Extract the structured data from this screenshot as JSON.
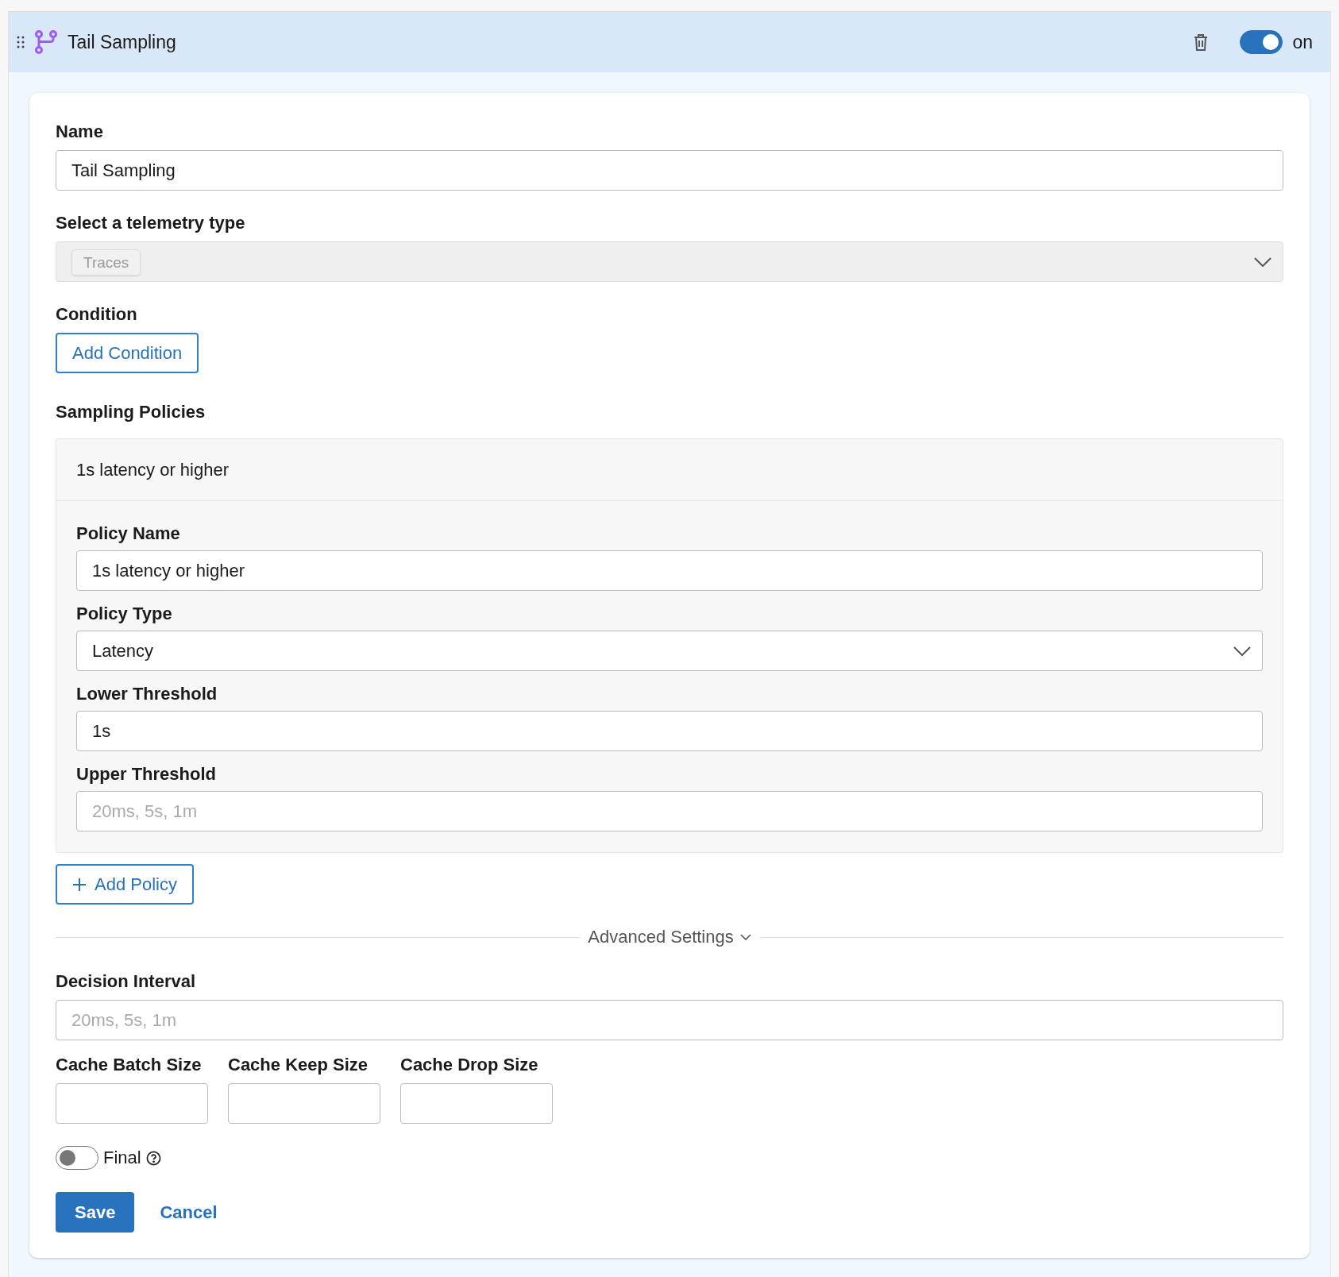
{
  "header": {
    "title": "Tail Sampling",
    "enabled": true,
    "toggle_label": "on"
  },
  "name": {
    "label": "Name",
    "value": "Tail Sampling"
  },
  "telemetry": {
    "label": "Select a telemetry type",
    "disabled": true,
    "tags": [
      "Traces"
    ]
  },
  "condition": {
    "label": "Condition",
    "button": "Add Condition"
  },
  "policies": {
    "label": "Sampling Policies",
    "items": [
      {
        "title": "1s latency or higher",
        "fields": [
          {
            "kind": "input",
            "label": "Policy Name",
            "value": "1s latency or higher"
          },
          {
            "kind": "select",
            "label": "Policy Type",
            "value": "Latency"
          },
          {
            "kind": "input",
            "label": "Lower Threshold",
            "value": "1s"
          },
          {
            "kind": "input",
            "label": "Upper Threshold",
            "placeholder": "20ms, 5s, 1m"
          }
        ]
      }
    ],
    "add_button": "Add Policy"
  },
  "advanced": {
    "label": "Advanced Settings",
    "decision_interval": {
      "label": "Decision Interval",
      "placeholder": "20ms, 5s, 1m"
    },
    "cache_fields": [
      {
        "label": "Cache Batch Size"
      },
      {
        "label": "Cache Keep Size"
      },
      {
        "label": "Cache Drop Size"
      }
    ],
    "final": {
      "label": "Final",
      "on": false
    }
  },
  "actions": {
    "save": "Save",
    "cancel": "Cancel"
  }
}
